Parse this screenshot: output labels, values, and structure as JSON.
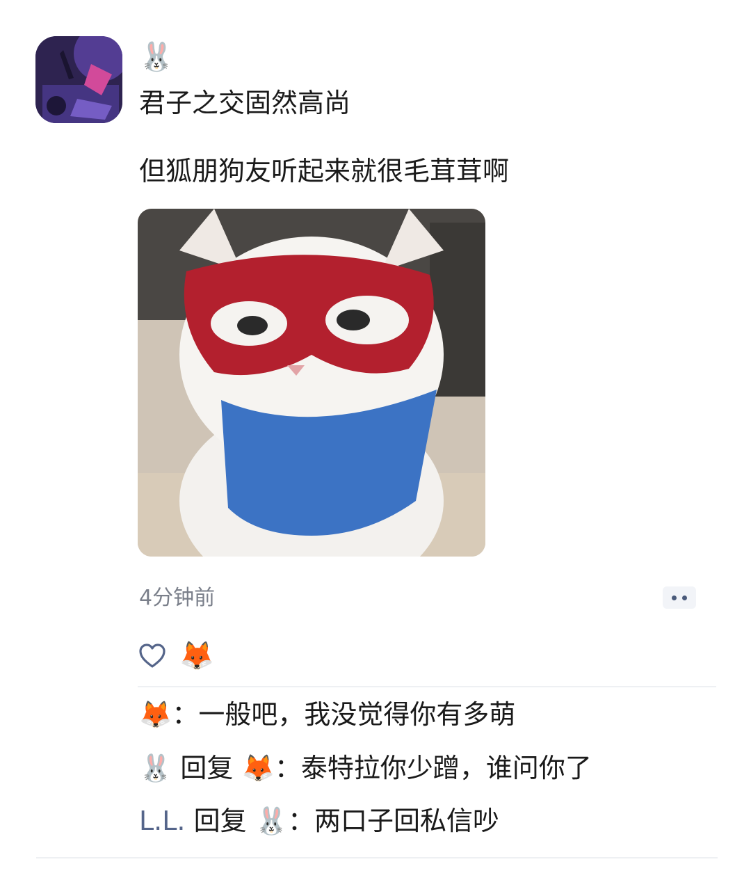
{
  "post": {
    "username": "🐰",
    "line1": "君子之交固然高尚",
    "line2": "但狐朋狗友听起来就很毛茸茸啊",
    "timestamp": "4分钟前"
  },
  "likes": {
    "likers": "🦊"
  },
  "comments": [
    {
      "author": "🦊",
      "separator": "：",
      "text": "一般吧，我没觉得你有多萌"
    },
    {
      "author": "🐰",
      "reply_word": " 回复 ",
      "reply_to": "🦊",
      "separator": "：",
      "text": "泰特拉你少蹭，谁问你了"
    },
    {
      "author": "L.L.",
      "reply_word": " 回复 ",
      "reply_to": "🐰",
      "separator": "：",
      "text": "两口子回私信吵"
    }
  ],
  "icons": {
    "more": "more-dots-icon",
    "like": "heart-icon"
  },
  "colors": {
    "name_link": "#55658a",
    "timestamp": "#7a7f8a",
    "heart_outline": "#55658a"
  }
}
